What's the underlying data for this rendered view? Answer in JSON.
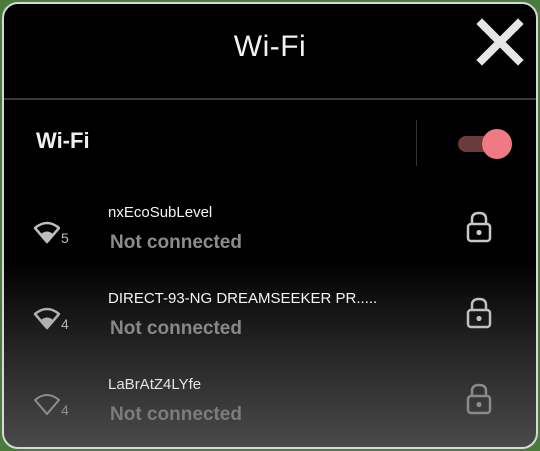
{
  "dialog": {
    "title": "Wi-Fi",
    "close_icon": "close-icon"
  },
  "toggle": {
    "label": "Wi-Fi",
    "state": "on",
    "on_color": "#f07a84"
  },
  "networks": [
    {
      "name": "nxEcoSubLevel",
      "status": "Not connected",
      "signal_number": "5",
      "locked": true
    },
    {
      "name": "DIRECT-93-NG DREAMSEEKER PR.....",
      "status": "Not connected",
      "signal_number": "4",
      "locked": true
    },
    {
      "name": "LaBrAtZ4LYfe",
      "status": "Not connected",
      "signal_number": "4",
      "locked": true
    }
  ]
}
